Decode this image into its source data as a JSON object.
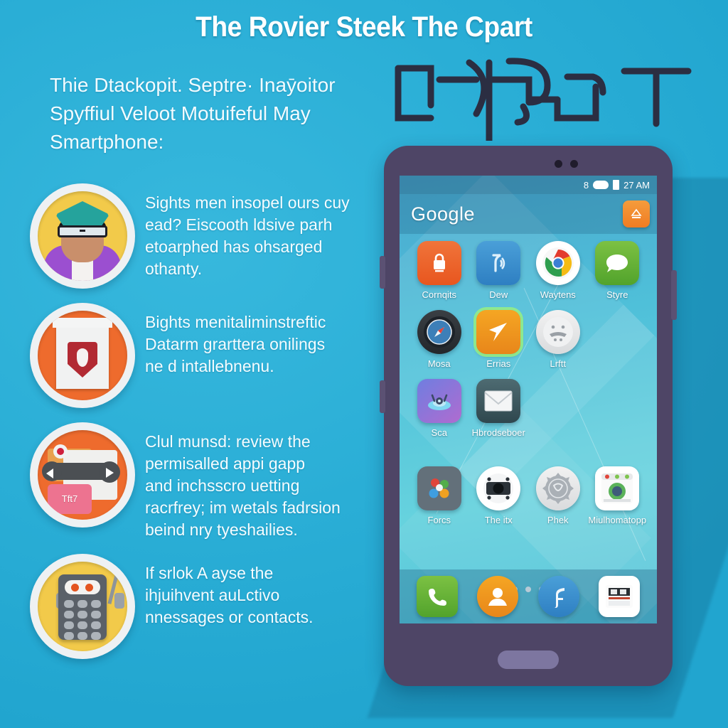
{
  "poster": {
    "background_color": "#2bb0d8",
    "headline": "The Rovier Steek The Cpart",
    "subtitle_lines": [
      "Thie Dtackopit. Septre· Inaȳoitor",
      "Spyffiul Veloot Motuifeful May",
      "Smartphone:"
    ],
    "decorative_glyphs_name": "abstract-line-art-glyphs"
  },
  "bullets": [
    {
      "icon": "person-avatar-icon",
      "icon_bg": "#f2ca4a",
      "lines": [
        "Sights men insopel ours cuy",
        "ead? Eiscooth ldsive parh",
        "etoarphed has ohsarged",
        "othanty."
      ]
    },
    {
      "icon": "shield-document-icon",
      "icon_bg": "#ee6b2d",
      "lines": [
        "Bights menitaliminstreftic",
        "Datarm grarttera onilings",
        "ne d intallebnenu."
      ]
    },
    {
      "icon": "media-transfer-icon",
      "icon_bg": "#ee6b2d",
      "card_label": "Tft7",
      "lines": [
        "Clul munsd: review the",
        "permisalled appi gapp",
        "and inchsscro uetting",
        "racrfrey; im wetals fadrsion",
        "beind nry tyeshailies."
      ]
    },
    {
      "icon": "robot-calculator-icon",
      "icon_bg": "#f2ca4a",
      "lines": [
        "If srlok A ayse the",
        "ihjuihvent auLctivo",
        "nnessages or contacts."
      ]
    }
  ],
  "phone": {
    "status_bar": {
      "signal": "8",
      "time": "27 AM"
    },
    "search": {
      "brand": "Google",
      "action_icon": "upload-icon"
    },
    "app_rows": [
      [
        {
          "label": "Cornqits",
          "icon": "lock-robot-icon",
          "style": "i-orange",
          "shape": "rounded",
          "highlight": false
        },
        {
          "label": "Dew",
          "icon": "wifi-signal-icon",
          "style": "i-blue",
          "shape": "rounded",
          "highlight": false
        },
        {
          "label": "Waytens",
          "icon": "chrome-browser-icon",
          "style": "i-white",
          "shape": "round",
          "highlight": false
        },
        {
          "label": "Styre",
          "icon": "chat-bubble-icon",
          "style": "i-green",
          "shape": "rounded",
          "highlight": false
        }
      ],
      [
        {
          "label": "Mosa",
          "icon": "compass-icon",
          "style": "i-darkgrey",
          "shape": "round",
          "highlight": false
        },
        {
          "label": "Errias",
          "icon": "navigation-arrow-icon",
          "style": "i-amber",
          "shape": "rounded",
          "highlight": true
        },
        {
          "label": "Lrftt",
          "icon": "face-icon",
          "style": "i-grey",
          "shape": "round",
          "highlight": false
        }
      ],
      [
        {
          "label": "Sca",
          "icon": "camera-drone-icon",
          "style": "i-purple",
          "shape": "rounded",
          "highlight": false
        },
        {
          "label": "Hbrodseboer",
          "icon": "mail-envelope-icon",
          "style": "i-dark",
          "shape": "rounded",
          "highlight": false
        }
      ],
      [
        {
          "label": "Forcs",
          "icon": "apps-grid-icon",
          "style": "i-slate",
          "shape": "rounded",
          "highlight": false
        },
        {
          "label": "The itx",
          "icon": "camera-icon",
          "style": "i-white",
          "shape": "round",
          "highlight": false
        },
        {
          "label": "Phek",
          "icon": "gear-settings-icon",
          "style": "i-grey",
          "shape": "round",
          "highlight": false
        },
        {
          "label": "Miulhomatopp",
          "icon": "browser-window-icon",
          "style": "i-white",
          "shape": "rounded",
          "highlight": false
        }
      ]
    ],
    "page_dots": {
      "count": 5,
      "active_index": 2
    },
    "dock": [
      {
        "icon": "phone-call-icon",
        "style": "i-green",
        "shape": "rounded"
      },
      {
        "icon": "contacts-person-icon",
        "style": "i-amber",
        "shape": "round"
      },
      {
        "icon": "flash-f-icon",
        "style": "i-blue",
        "shape": "round"
      },
      {
        "icon": "calculator-app-icon",
        "style": "i-white",
        "shape": "rounded"
      }
    ]
  }
}
